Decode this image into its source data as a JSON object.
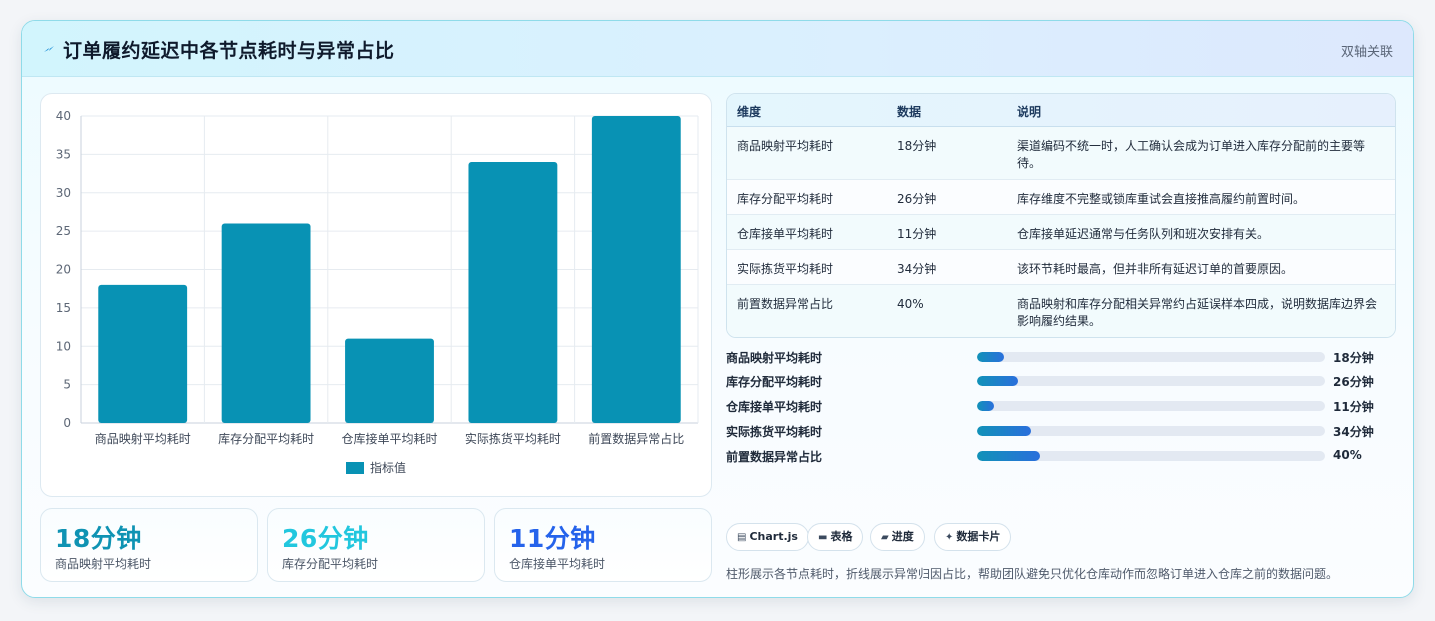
{
  "header": {
    "title": "订单履约延迟中各节点耗时与异常占比",
    "tag": "双轴关联"
  },
  "colors": {
    "bar": "#0892b4",
    "stat1": "#0f93b3",
    "stat2": "#22c7de",
    "stat3": "#2563eb"
  },
  "chart_data": {
    "type": "bar",
    "categories": [
      "商品映射平均耗时",
      "库存分配平均耗时",
      "仓库接单平均耗时",
      "实际拣货平均耗时",
      "前置数据异常占比"
    ],
    "series": [
      {
        "name": "指标值",
        "values": [
          18,
          26,
          11,
          34,
          40
        ]
      }
    ],
    "ylim": [
      0,
      40
    ],
    "yticks": [
      0,
      5,
      10,
      15,
      20,
      25,
      30,
      35,
      40
    ],
    "grid": true,
    "legend": "bottom"
  },
  "stats": [
    {
      "value": "18分钟",
      "label": "商品映射平均耗时"
    },
    {
      "value": "26分钟",
      "label": "库存分配平均耗时"
    },
    {
      "value": "11分钟",
      "label": "仓库接单平均耗时"
    }
  ],
  "table": {
    "headers": [
      "维度",
      "数据",
      "说明"
    ],
    "rows": [
      {
        "dim": "商品映射平均耗时",
        "data": "18分钟",
        "desc": "渠道编码不统一时，人工确认会成为订单进入库存分配前的主要等待。"
      },
      {
        "dim": "库存分配平均耗时",
        "data": "26分钟",
        "desc": "库存维度不完整或锁库重试会直接推高履约前置时间。"
      },
      {
        "dim": "仓库接单平均耗时",
        "data": "11分钟",
        "desc": "仓库接单延迟通常与任务队列和班次安排有关。"
      },
      {
        "dim": "实际拣货平均耗时",
        "data": "34分钟",
        "desc": "该环节耗时最高，但并非所有延迟订单的首要原因。"
      },
      {
        "dim": "前置数据异常占比",
        "data": "40%",
        "desc": "商品映射和库存分配相关异常约占延误样本四成，说明数据库边界会影响履约结果。"
      }
    ]
  },
  "progress": [
    {
      "label": "商品映射平均耗时",
      "value": "18分钟",
      "fraction": 0.078
    },
    {
      "label": "库存分配平均耗时",
      "value": "26分钟",
      "fraction": 0.117
    },
    {
      "label": "仓库接单平均耗时",
      "value": "11分钟",
      "fraction": 0.048
    },
    {
      "label": "实际拣货平均耗时",
      "value": "34分钟",
      "fraction": 0.155
    },
    {
      "label": "前置数据异常占比",
      "value": "40%",
      "fraction": 0.182
    }
  ],
  "chips": [
    {
      "icon": "chart-icon",
      "glyph": "▤",
      "label": "Chart.js"
    },
    {
      "icon": "table-icon",
      "glyph": "▬",
      "label": "表格"
    },
    {
      "icon": "folder-icon",
      "glyph": "▰",
      "label": "进度"
    },
    {
      "icon": "sparkle-icon",
      "glyph": "✦",
      "label": "数据卡片"
    }
  ],
  "footnote": "柱形展示各节点耗时，折线展示异常归因占比，帮助团队避免只优化仓库动作而忽略订单进入仓库之前的数据问题。"
}
